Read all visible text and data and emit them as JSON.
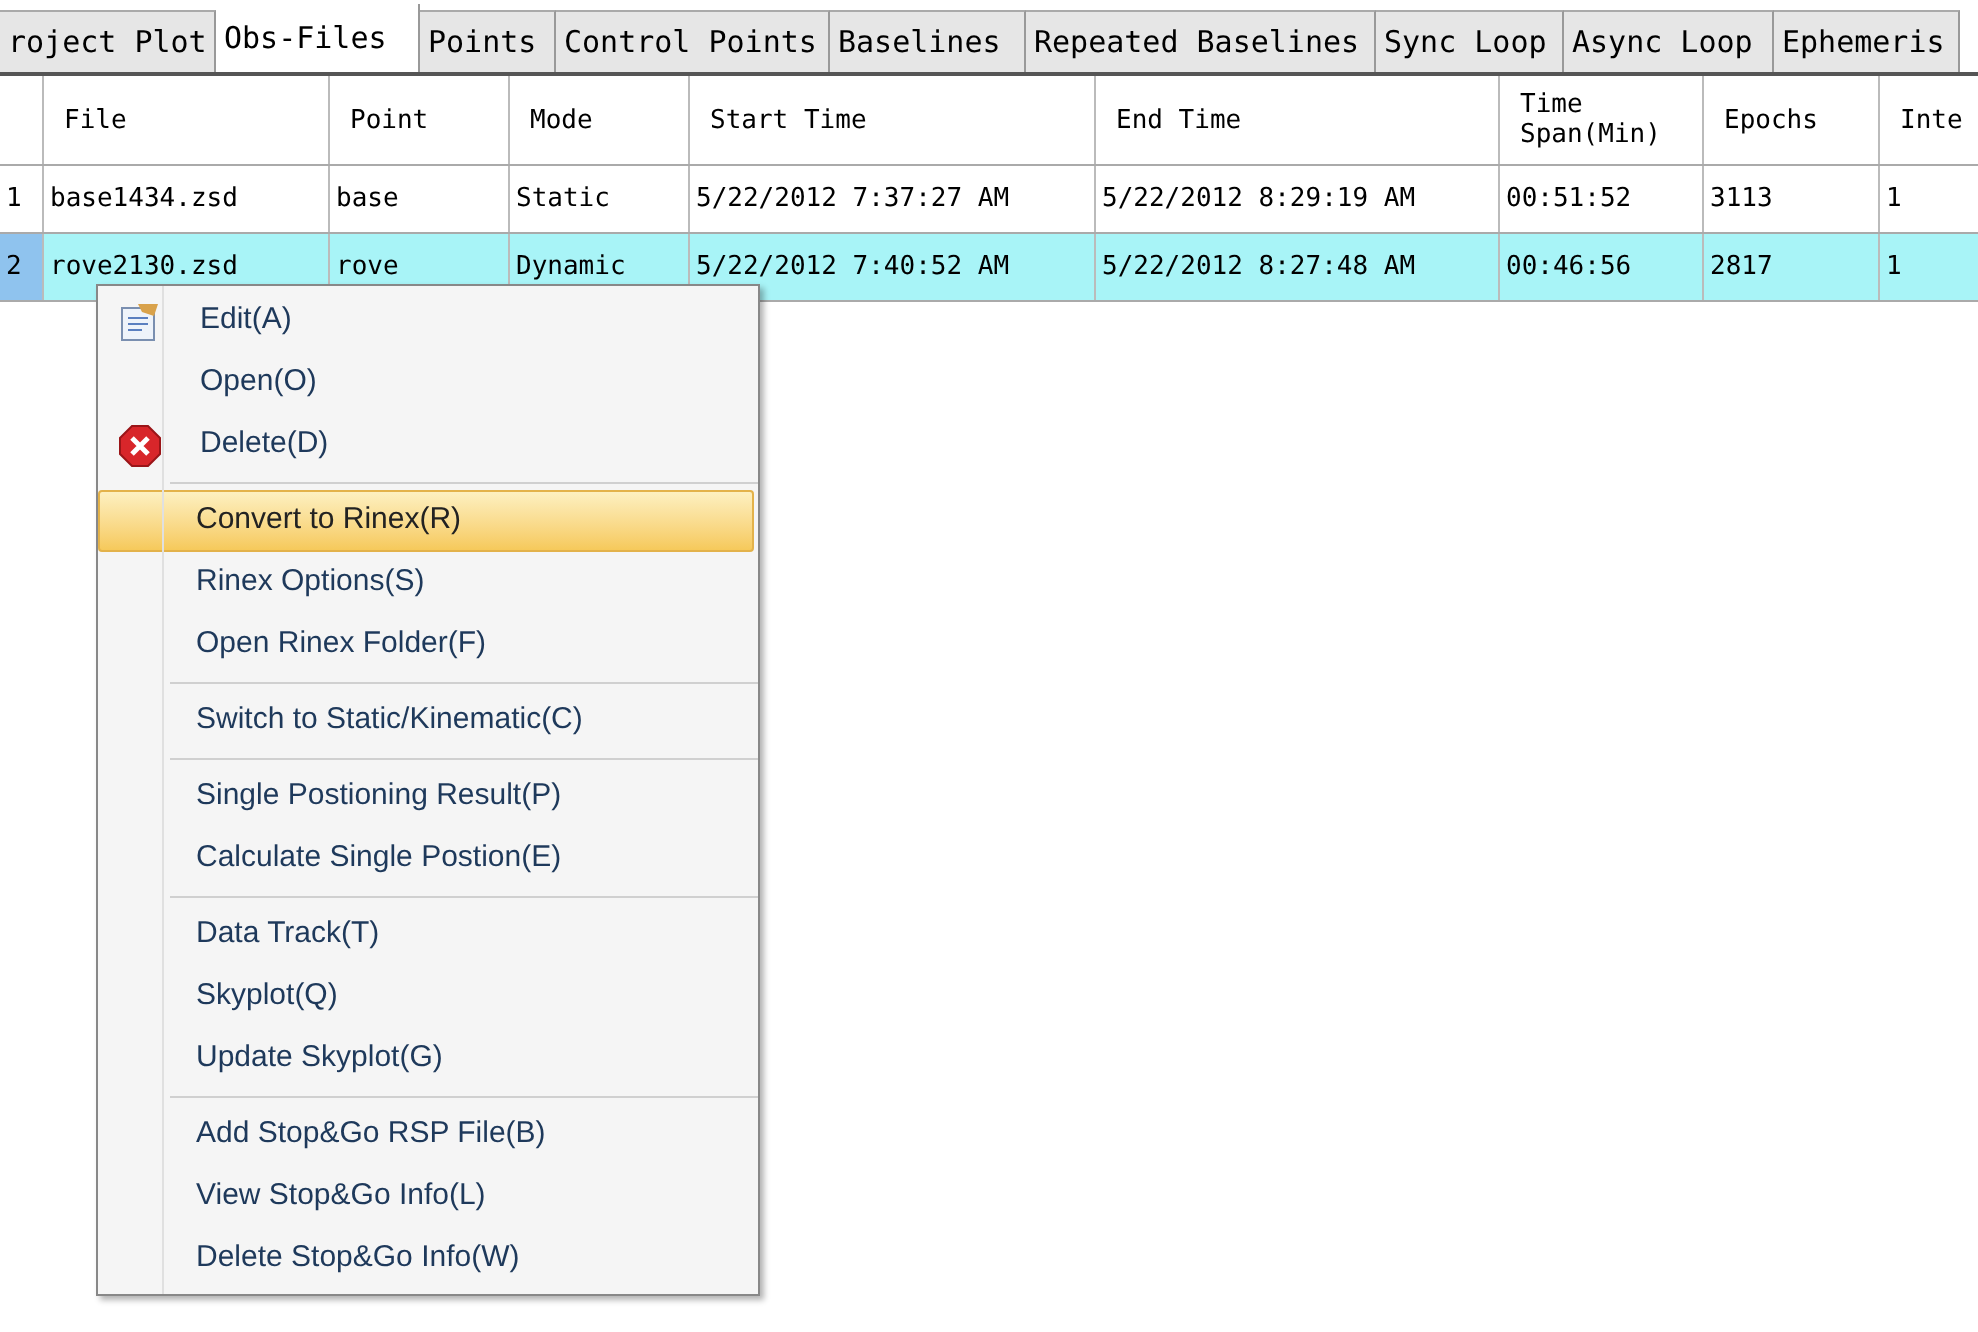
{
  "tabs": [
    {
      "label": "roject Plot",
      "selected": false
    },
    {
      "label": "Obs-Files",
      "selected": true
    },
    {
      "label": "Points",
      "selected": false
    },
    {
      "label": "Control Points",
      "selected": false
    },
    {
      "label": "Baselines",
      "selected": false
    },
    {
      "label": "Repeated Baselines",
      "selected": false
    },
    {
      "label": "Sync Loop",
      "selected": false
    },
    {
      "label": "Async Loop",
      "selected": false
    },
    {
      "label": "Ephemeris",
      "selected": false
    }
  ],
  "table": {
    "columns": [
      "File",
      "Point",
      "Mode",
      "Start Time",
      "End Time",
      "Time Span(Min)",
      "Epochs",
      "Inte"
    ],
    "rows": [
      {
        "number": "1",
        "selected": false,
        "cells": [
          "base1434.zsd",
          "base",
          "Static",
          "5/22/2012 7:37:27 AM",
          "5/22/2012 8:29:19 AM",
          "00:51:52",
          "3113",
          "1"
        ]
      },
      {
        "number": "2",
        "selected": true,
        "cells": [
          "rove2130.zsd",
          "rove",
          "Dynamic",
          "5/22/2012 7:40:52 AM",
          "5/22/2012 8:27:48 AM",
          "00:46:56",
          "2817",
          "1"
        ]
      }
    ]
  },
  "context_menu": {
    "groups": [
      [
        {
          "label": "Edit(A)",
          "kind": "edit",
          "highlighted": false
        },
        {
          "label": "Open(O)",
          "kind": "plain",
          "highlighted": false
        },
        {
          "label": "Delete(D)",
          "kind": "delete",
          "highlighted": false
        }
      ],
      [
        {
          "label": "Convert to Rinex(R)",
          "highlighted": true
        },
        {
          "label": "Rinex Options(S)",
          "highlighted": false
        },
        {
          "label": "Open Rinex Folder(F)",
          "highlighted": false
        }
      ],
      [
        {
          "label": "Switch to Static/Kinematic(C)",
          "highlighted": false
        }
      ],
      [
        {
          "label": "Single Postioning Result(P)",
          "highlighted": false
        },
        {
          "label": "Calculate Single Postion(E)",
          "highlighted": false
        }
      ],
      [
        {
          "label": "Data Track(T)",
          "highlighted": false
        },
        {
          "label": "Skyplot(Q)",
          "highlighted": false
        },
        {
          "label": "Update Skyplot(G)",
          "highlighted": false
        }
      ],
      [
        {
          "label": "Add Stop&Go RSP File(B)",
          "highlighted": false
        },
        {
          "label": "View Stop&Go Info(L)",
          "highlighted": false
        },
        {
          "label": "Delete Stop&Go Info(W)",
          "highlighted": false
        }
      ]
    ]
  }
}
